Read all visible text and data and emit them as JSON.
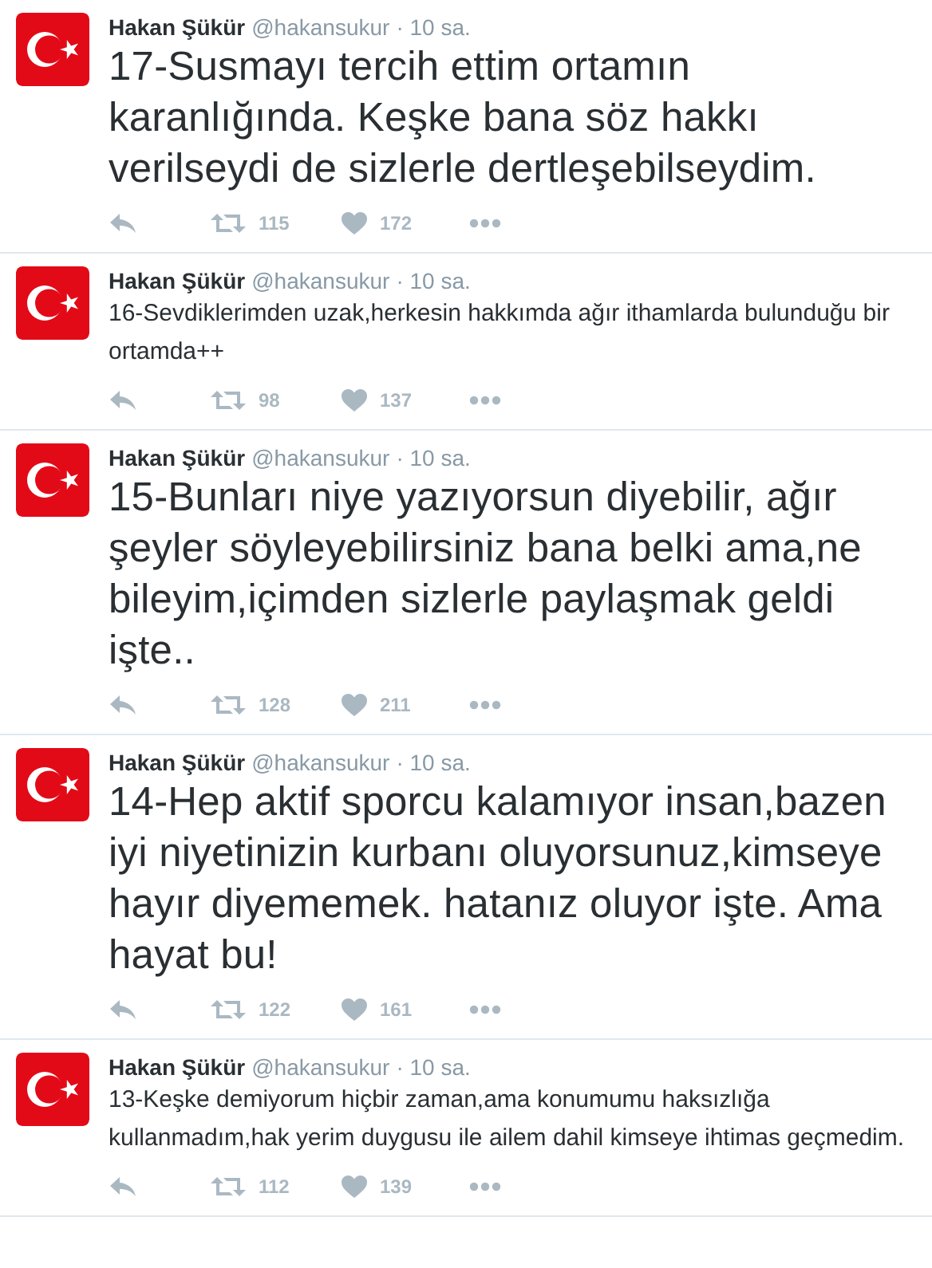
{
  "tweets": [
    {
      "author": "Hakan Şükür",
      "handle": "@hakansukur",
      "time": "· 10 sa.",
      "kind": "large",
      "text": "17-Susmayı tercih ettim ortamın karanlığında. Keşke bana söz hakkı verilseydi de sizlerle dertleşebilseydim.",
      "retweets": "115",
      "likes": "172"
    },
    {
      "author": "Hakan Şükür",
      "handle": "@hakansukur",
      "time": "· 10 sa.",
      "kind": "normal",
      "text": "16-Sevdiklerimden uzak,herkesin hakkımda ağır ithamlarda bulunduğu bir ortamda++",
      "retweets": "98",
      "likes": "137"
    },
    {
      "author": "Hakan Şükür",
      "handle": "@hakansukur",
      "time": "· 10 sa.",
      "kind": "large",
      "text": "15-Bunları niye yazıyorsun diyebilir, ağır şeyler söyleyebilirsiniz bana belki ama,ne bileyim,içimden sizlerle paylaşmak geldi işte..",
      "retweets": "128",
      "likes": "211"
    },
    {
      "author": "Hakan Şükür",
      "handle": "@hakansukur",
      "time": "· 10 sa.",
      "kind": "large",
      "text": "14-Hep aktif sporcu kalamıyor insan,bazen iyi niyetinizin kurbanı oluyorsunuz,kimseye hayır diyememek. hatanız oluyor işte. Ama hayat bu!",
      "retweets": "122",
      "likes": "161"
    },
    {
      "author": "Hakan Şükür",
      "handle": "@hakansukur",
      "time": "· 10 sa.",
      "kind": "normal",
      "text": "13-Keşke demiyorum hiçbir zaman,ama konumumu haksızlığa kullanmadım,hak yerim duygusu ile ailem dahil kimseye ihtimas geçmedim.",
      "retweets": "112",
      "likes": "139"
    }
  ]
}
